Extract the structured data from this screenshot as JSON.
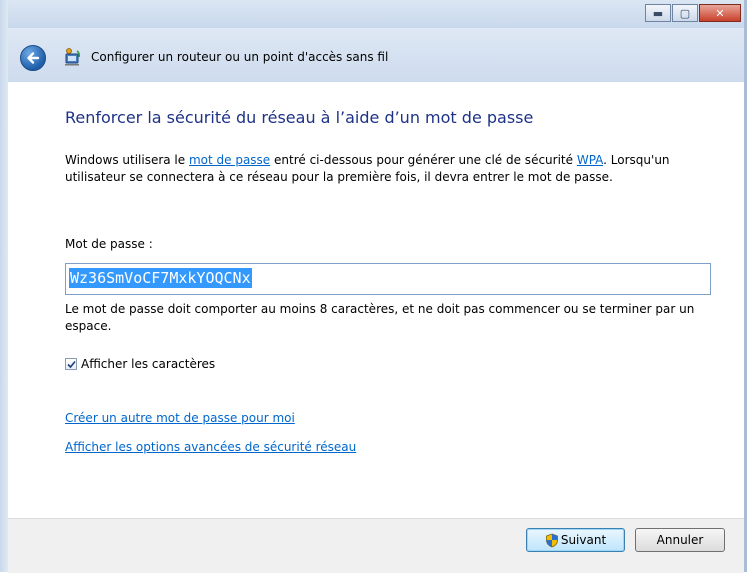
{
  "window": {
    "title": "Configurer un routeur ou un point d'accès sans fil",
    "caption_buttons": {
      "minimize_glyph": "▬",
      "maximize_glyph": "▢",
      "close_glyph": "✕"
    }
  },
  "page": {
    "heading": "Renforcer la sécurité du réseau à l’aide d’un mot de passe",
    "intro": {
      "part1": "Windows utilisera le ",
      "link1": "mot de passe",
      "part2": " entré ci-dessous pour générer une clé de sécurité ",
      "link2": "WPA",
      "part3": ". Lorsqu'un utilisateur se connectera à ce réseau pour la première fois, il devra entrer le mot de passe."
    },
    "password_label": "Mot de passe :",
    "password_value": "Wz36SmVoCF7MxkYOQCNx",
    "hint": "Le mot de passe doit comporter au moins 8 caractères, et ne doit pas commencer ou se terminer par un espace.",
    "show_chars": {
      "label": "Afficher les caractères",
      "checked": true
    },
    "links": {
      "generate": "Créer un autre mot de passe pour moi",
      "advanced": "Afficher les options avancées de sécurité réseau"
    }
  },
  "footer": {
    "next_label": "Suivant",
    "cancel_label": "Annuler"
  },
  "icons": {
    "back": "back-arrow-icon",
    "wizard": "network-wizard-icon",
    "shield": "uac-shield-icon"
  },
  "colors": {
    "heading": "#1e3287",
    "link": "#0066cc",
    "selection": "#3399ff"
  }
}
